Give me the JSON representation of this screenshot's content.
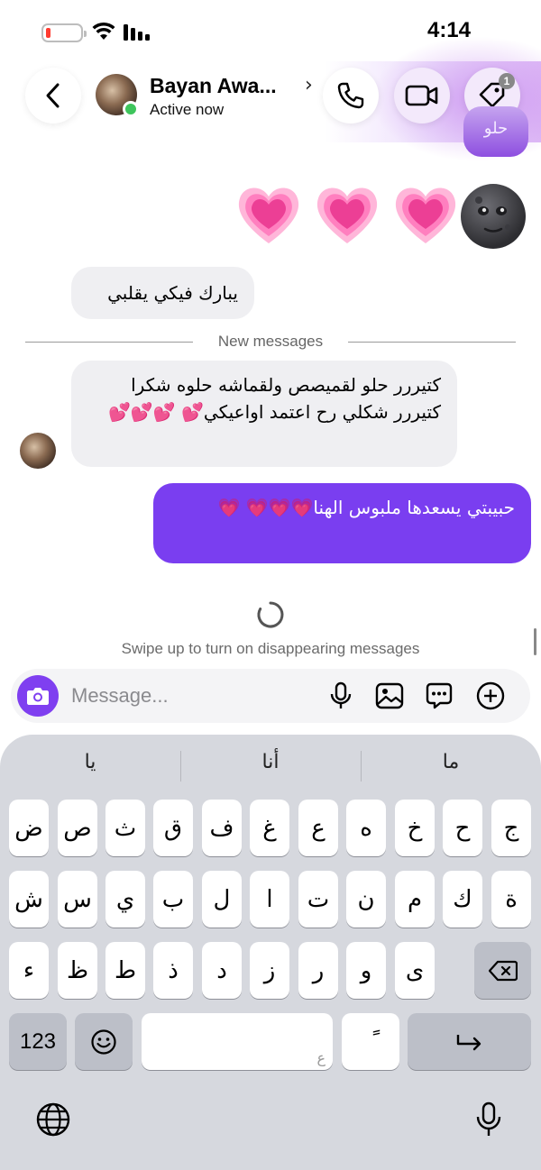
{
  "status_bar": {
    "time": "4:14",
    "battery_level": 0.1,
    "battery_color": "#ff3b30",
    "icons": [
      "battery-icon",
      "wifi-icon",
      "signal-icon"
    ]
  },
  "header": {
    "contact_name": "Bayan Awa...",
    "status": "Active now",
    "status_color": "#3ec55c",
    "buttons": [
      "back-icon",
      "phone-icon",
      "video-icon",
      "tag-icon"
    ],
    "tag_badge": "1"
  },
  "conversation": {
    "partial_bubble": "حلو",
    "reaction_emoji": "💗💗💗",
    "messages": [
      {
        "direction": "incoming",
        "text": "يبارك فيكي يقلبي"
      },
      {
        "direction": "incoming",
        "text": "كتيررر حلو لقميصص ولقماشه حلوه شكرا كتيررر شكلي رح اعتمد اواعيكي💕 💕💕💕"
      },
      {
        "direction": "outgoing",
        "text": "حبيبتي يسعدها ملبوس الهنا💗💗💗 💗"
      }
    ],
    "divider_label": "New messages",
    "disappearing_hint": "Swipe up to turn on disappearing messages"
  },
  "composer": {
    "placeholder": "Message...",
    "icons": [
      "camera-icon",
      "microphone-icon",
      "image-icon",
      "sticker-icon",
      "plus-icon"
    ]
  },
  "keyboard": {
    "suggestions": [
      "يا",
      "أنا",
      "ما"
    ],
    "row1": [
      "ض",
      "ص",
      "ث",
      "ق",
      "ف",
      "غ",
      "ع",
      "ه",
      "خ",
      "ح",
      "ج"
    ],
    "row2": [
      "ش",
      "س",
      "ي",
      "ب",
      "ل",
      "ا",
      "ت",
      "ن",
      "م",
      "ك",
      "ة"
    ],
    "row3": [
      "ء",
      "ظ",
      "ط",
      "ذ",
      "د",
      "ز",
      "ر",
      "و",
      "ى"
    ],
    "numbers_key": "123",
    "space_hint": "ع",
    "diacritic_key": "ً",
    "bottom_icons": [
      "emoji-icon",
      "return-icon",
      "delete-icon",
      "globe-icon",
      "dictation-icon"
    ]
  },
  "colors": {
    "accent": "#7a3ef0",
    "incoming_bubble": "#efeff2",
    "keyboard_bg": "#d6d8de"
  }
}
